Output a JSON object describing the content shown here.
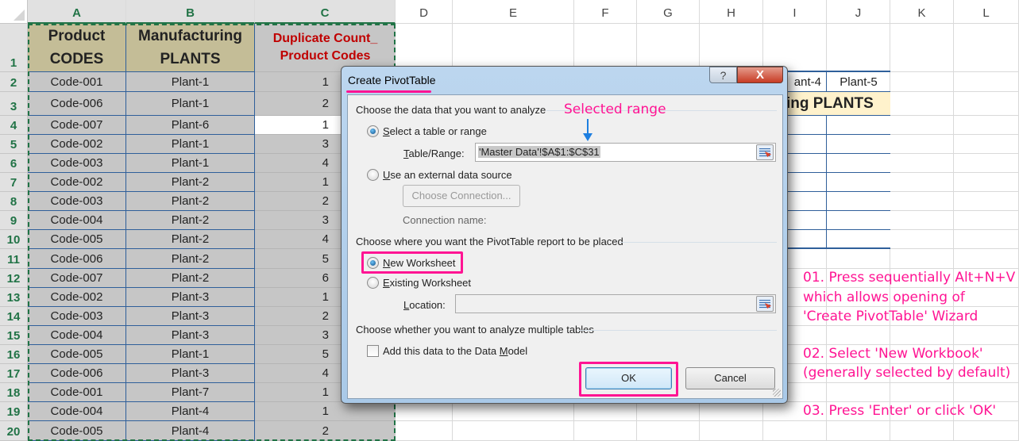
{
  "sheet": {
    "columns": [
      "A",
      "B",
      "C",
      "D",
      "E",
      "F",
      "G",
      "H",
      "I",
      "J",
      "K",
      "L"
    ],
    "selected_columns": [
      "A",
      "B",
      "C"
    ],
    "headers": {
      "A": [
        "Product",
        "CODES"
      ],
      "B": [
        "Manufacturing",
        "PLANTS"
      ],
      "C": [
        "Duplicate Count_",
        "Product Codes"
      ]
    },
    "rows": [
      {
        "num": "1"
      },
      {
        "num": "2",
        "code": "Code-001",
        "plant": "Plant-1",
        "count": "1"
      },
      {
        "num": "3",
        "code": "Code-006",
        "plant": "Plant-1",
        "count": "2"
      },
      {
        "num": "4",
        "code": "Code-007",
        "plant": "Plant-6",
        "count": "1"
      },
      {
        "num": "5",
        "code": "Code-002",
        "plant": "Plant-1",
        "count": "3"
      },
      {
        "num": "6",
        "code": "Code-003",
        "plant": "Plant-1",
        "count": "4"
      },
      {
        "num": "7",
        "code": "Code-002",
        "plant": "Plant-2",
        "count": "1"
      },
      {
        "num": "8",
        "code": "Code-003",
        "plant": "Plant-2",
        "count": "2"
      },
      {
        "num": "9",
        "code": "Code-004",
        "plant": "Plant-2",
        "count": "3"
      },
      {
        "num": "10",
        "code": "Code-005",
        "plant": "Plant-2",
        "count": "4"
      },
      {
        "num": "11",
        "code": "Code-006",
        "plant": "Plant-2",
        "count": "5"
      },
      {
        "num": "12",
        "code": "Code-007",
        "plant": "Plant-2",
        "count": "6"
      },
      {
        "num": "13",
        "code": "Code-002",
        "plant": "Plant-3",
        "count": "1"
      },
      {
        "num": "14",
        "code": "Code-003",
        "plant": "Plant-3",
        "count": "2"
      },
      {
        "num": "15",
        "code": "Code-004",
        "plant": "Plant-3",
        "count": "3"
      },
      {
        "num": "16",
        "code": "Code-005",
        "plant": "Plant-1",
        "count": "5"
      },
      {
        "num": "17",
        "code": "Code-006",
        "plant": "Plant-3",
        "count": "4"
      },
      {
        "num": "18",
        "code": "Code-001",
        "plant": "Plant-7",
        "count": "1"
      },
      {
        "num": "19",
        "code": "Code-004",
        "plant": "Plant-4",
        "count": "1"
      },
      {
        "num": "20",
        "code": "Code-005",
        "plant": "Plant-4",
        "count": "2"
      }
    ],
    "right_table": {
      "i2": "ant-4",
      "j2": "Plant-5",
      "title_partial": "uring PLANTS"
    },
    "notes": [
      "01. Press sequentially Alt+N+V",
      "which allows opening of",
      "'Create PivotTable' Wizard",
      "02. Select 'New Workbook'",
      "(generally selected by default)",
      "03. Press 'Enter' or click 'OK'"
    ]
  },
  "dialog": {
    "title": "Create PivotTable",
    "help_icon": "?",
    "close_icon": "X",
    "section1": "Choose the data that you want to analyze",
    "radio_select_range": "elect a table or range",
    "radio_select_range_key": "S",
    "table_range_label_key": "T",
    "table_range_label": "able/Range:",
    "table_range_value": "'Master Data'!$A$1:$C$31",
    "radio_external_key": "U",
    "radio_external": "se an external data source",
    "choose_connection": "Choose Connection...",
    "connection_name_label": "Connection name:",
    "section2": "Choose where you want the PivotTable report to be placed",
    "radio_new_key": "N",
    "radio_new": "ew Worksheet",
    "radio_existing_key": "E",
    "radio_existing": "xisting Worksheet",
    "location_key": "L",
    "location_label": "ocation:",
    "location_value": "",
    "section3": "Choose whether you want to analyze multiple tables",
    "add_model_pre": "Add this data to the Data ",
    "add_model_key": "M",
    "add_model_post": "odel",
    "ok": "OK",
    "cancel": "Cancel",
    "selected_option": "New Worksheet",
    "select_range_checked": true,
    "add_to_model_checked": false
  },
  "annotations": {
    "selected_range": "Selected range",
    "accent_color": "#ff1493",
    "arrow_color": "#1e7fe0"
  }
}
